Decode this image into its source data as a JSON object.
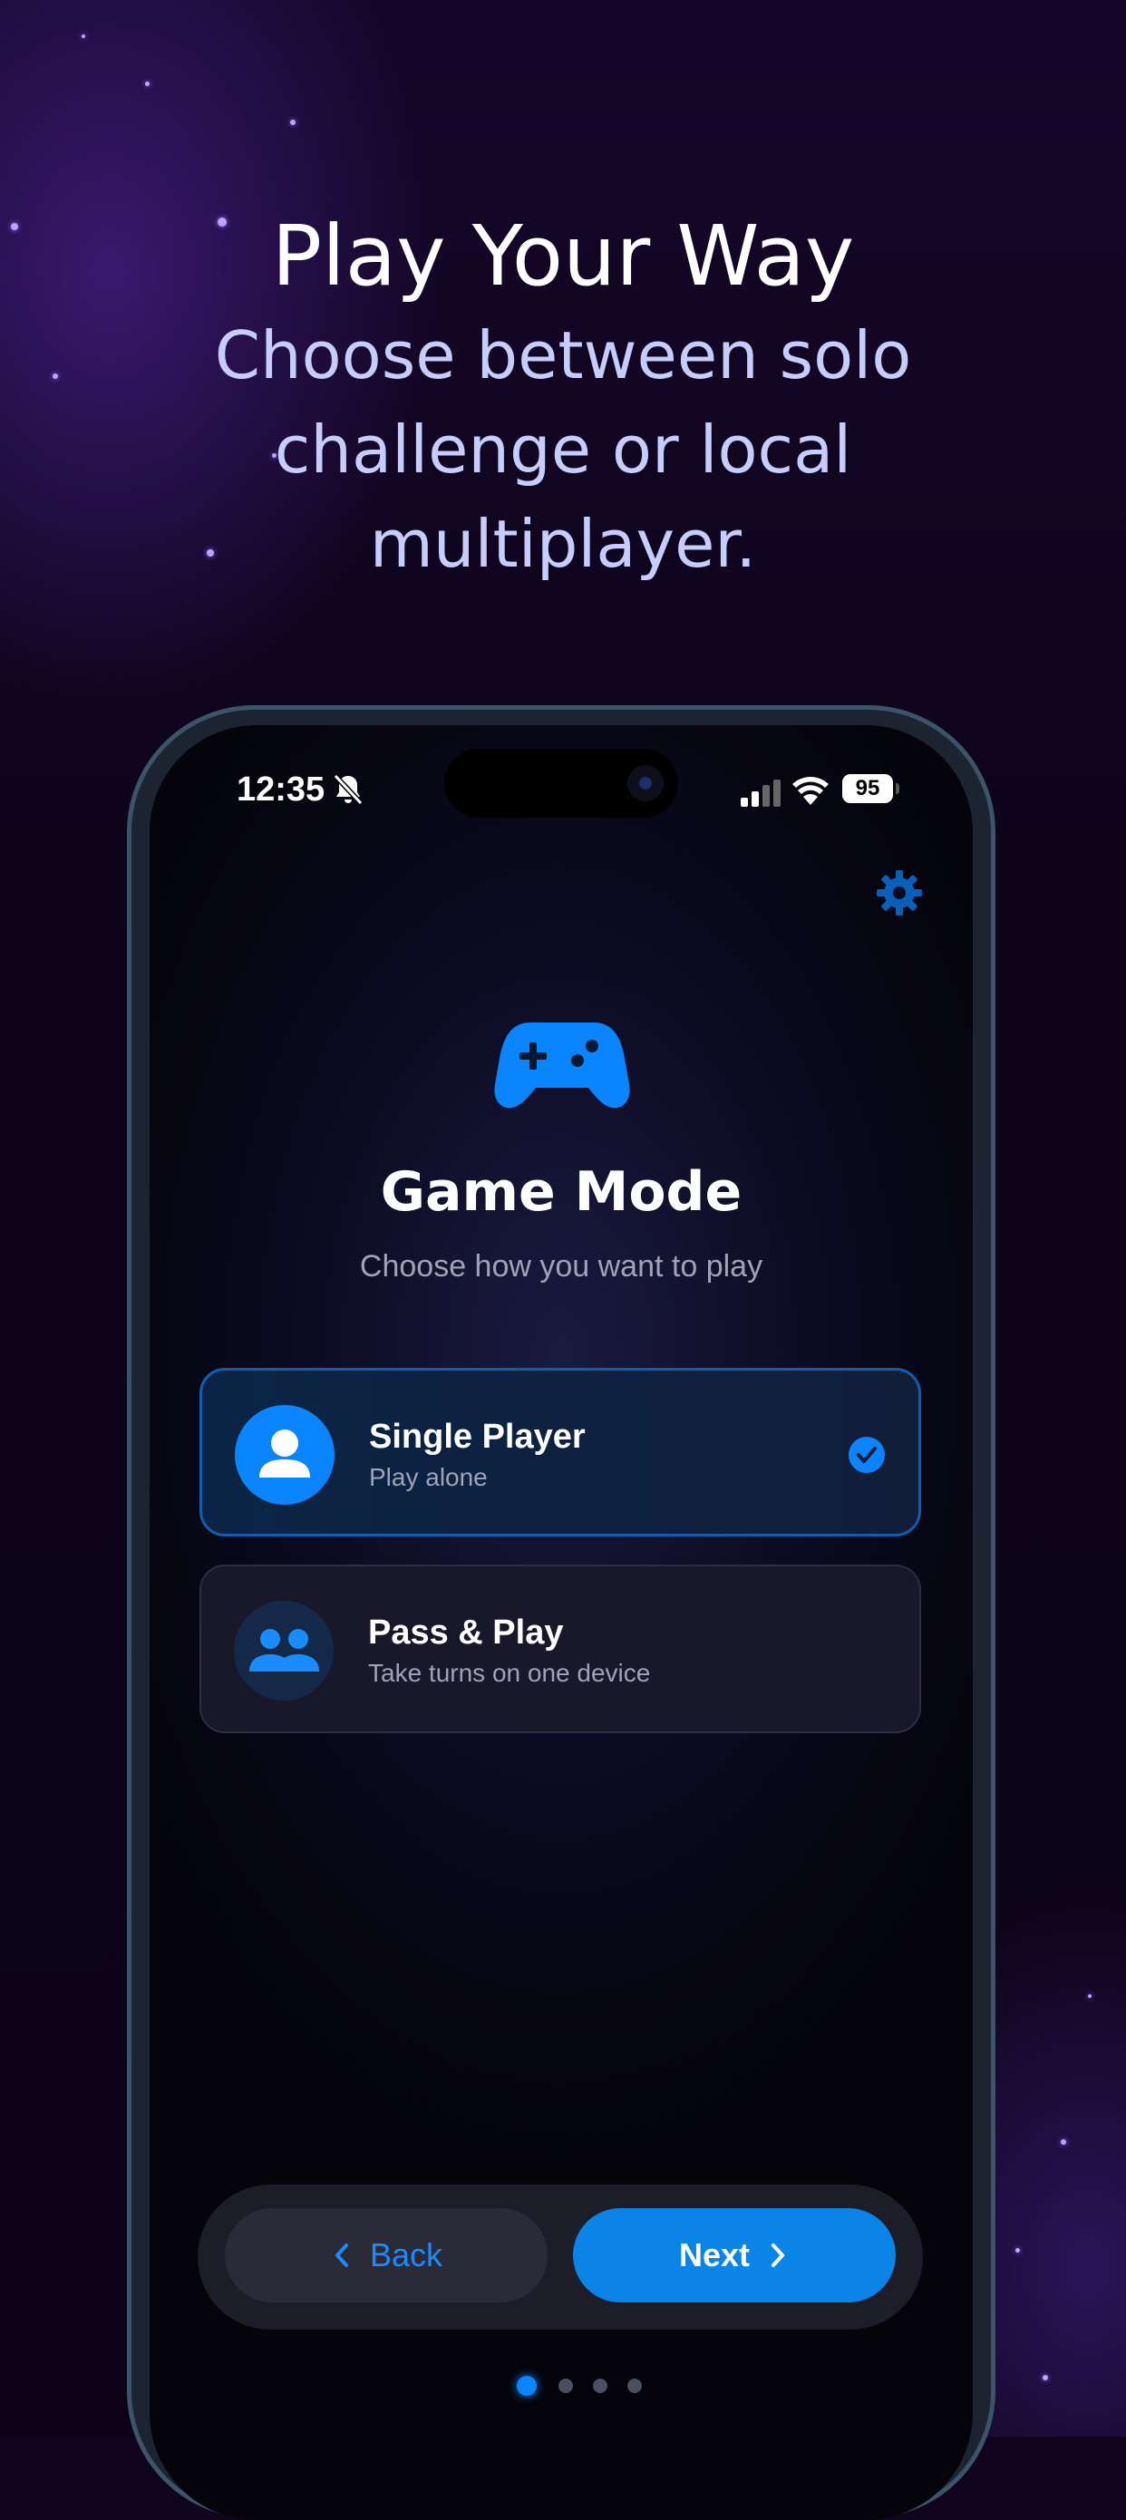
{
  "promo": {
    "headline": "Play Your Way",
    "subline": "Choose between solo challenge or local multiplayer."
  },
  "status_bar": {
    "time": "12:35",
    "battery": "95",
    "icons": [
      "bell-slash-icon",
      "cellular-signal-icon",
      "wifi-icon",
      "battery-icon"
    ]
  },
  "screen": {
    "settings_icon": "gear-icon",
    "hero_icon": "gamepad-icon",
    "title": "Game Mode",
    "subtitle": "Choose how you want to play",
    "options": [
      {
        "title": "Single Player",
        "subtitle": "Play alone",
        "icon": "person-icon",
        "selected": true
      },
      {
        "title": "Pass & Play",
        "subtitle": "Take turns on one device",
        "icon": "people-icon",
        "selected": false
      }
    ],
    "nav": {
      "back_label": "Back",
      "next_label": "Next"
    },
    "pager": {
      "total": 4,
      "current": 1
    }
  },
  "colors": {
    "accent": "#0a84ff",
    "background": "#10051c",
    "subline": "#c7cdfb"
  }
}
